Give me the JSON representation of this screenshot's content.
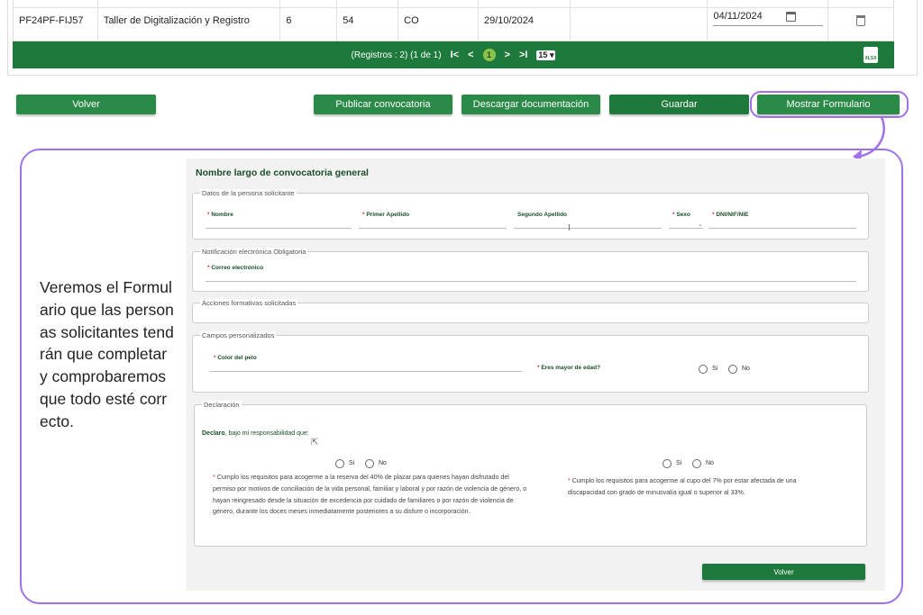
{
  "table": {
    "row": {
      "code": "PF24PF-FIJ57",
      "name": "Taller de Digitalización y Registro",
      "col3": "6",
      "col4": "54",
      "col5": "CO",
      "date1": "29/10/2024",
      "date2": "04/11/2024"
    },
    "pager": {
      "info": "(Registros : 2) (1 de 1)",
      "first": "I<",
      "prev": "<",
      "current": "1",
      "next": ">",
      "last": ">I",
      "page_size": "15"
    },
    "export_icon_label": "XLSX"
  },
  "actions": {
    "back": "Volver",
    "publish": "Publicar convocatoria",
    "download": "Descargar documentación",
    "save": "Guardar",
    "show_form": "Mostrar Formulario"
  },
  "description": "Veremos el Formulario que las personas solicitantes tendrán que completar y comprobaremos que todo esté correcto.",
  "form": {
    "title": "Nombre largo de convocatoria general",
    "applicant": {
      "legend": "Datos de la persona solicitante",
      "name": "Nombre",
      "first_surname": "Primer Apellido",
      "second_surname": "Segundo Apellido",
      "sex": "Sexo",
      "id": "DNI/NIF/NIE"
    },
    "notification": {
      "legend": "Notificación electrónica Obligatoria",
      "email": "Correo electrónico"
    },
    "training": {
      "legend": "Acciones formativas solicitadas"
    },
    "custom": {
      "legend": "Campos personalizados",
      "hair_color": "Color del pelo",
      "adult": "Eres mayor de edad?",
      "yes": "Si",
      "no": "No"
    },
    "declaration": {
      "legend": "Declaración",
      "intro_bold": "Declaro",
      "intro_rest": ", bajo mi responsabilidad que:",
      "yes": "Si",
      "no": "No",
      "text1": "Cumplo los requisitos para acogerme a la reserva del 40% de plazar para quienes hayan disfrutado del permiso por motivos de conciliación de la vida personal, familiar y laboral y por razón de violencia de género, o hayan reingresado desde la situación de excedencia por cuidado de familiares o por razón de violencia de género, durante los doces meses inmediatamente posteriores a su disfure o incorporación.",
      "text2": "Cumplo los requisitos para acogerme al cupo del 7% por estar afectada de una discapacidad con grado de minusvalía igual o superior al 33%."
    },
    "back_button": "Volver"
  },
  "colors": {
    "primary_green": "#1e7a3c",
    "highlight_purple": "#a070e8",
    "label_green": "#1a4d2a",
    "required_red": "#d33"
  }
}
